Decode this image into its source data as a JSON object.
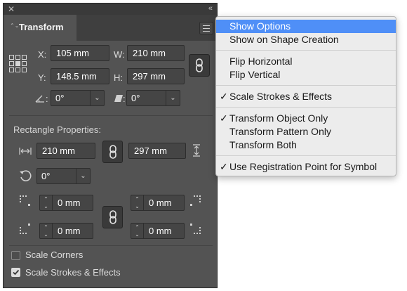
{
  "panel": {
    "tab_label": "Transform",
    "tab_arrows_glyph": "⌃⌄",
    "close_glyph": "✕",
    "collapse_glyph": "«",
    "x_label": "X:",
    "x_value": "105 mm",
    "y_label": "Y:",
    "y_value": "148.5 mm",
    "w_label": "W:",
    "w_value": "210 mm",
    "h_label": "H:",
    "h_value": "297 mm",
    "angle_colon": ":",
    "angle_value": "0°",
    "shear_colon": ":",
    "shear_value": "0°",
    "rect_section_title": "Rectangle Properties:",
    "rect_width_value": "210 mm",
    "rect_height_value": "297 mm",
    "rect_rotation_value": "0°",
    "corner_tl_value": "0 mm",
    "corner_tr_value": "0 mm",
    "corner_bl_value": "0 mm",
    "corner_br_value": "0 mm",
    "scale_corners_label": "Scale Corners",
    "scale_corners_checked": false,
    "scale_strokes_label": "Scale Strokes & Effects",
    "scale_strokes_checked": true,
    "checkmark_glyph": "✓",
    "dropdown_arrow": "⌄",
    "spin_up": "⌃",
    "spin_down": "⌄"
  },
  "menu": {
    "check_glyph": "✓",
    "items": [
      {
        "label": "Show Options",
        "checked": false,
        "highlighted": true
      },
      {
        "label": "Show on Shape Creation",
        "checked": false
      },
      {
        "label": "Flip Horizontal",
        "checked": false
      },
      {
        "label": "Flip Vertical",
        "checked": false
      },
      {
        "label": "Scale Strokes & Effects",
        "checked": true
      },
      {
        "label": "Transform Object Only",
        "checked": true
      },
      {
        "label": "Transform Pattern Only",
        "checked": false
      },
      {
        "label": "Transform Both",
        "checked": false
      },
      {
        "label": "Use Registration Point for Symbol",
        "checked": true
      }
    ]
  },
  "colors": {
    "panel_bg": "#535353",
    "field_bg": "#454545",
    "menu_bg": "#ececec",
    "menu_highlight": "#4f8ff7"
  }
}
